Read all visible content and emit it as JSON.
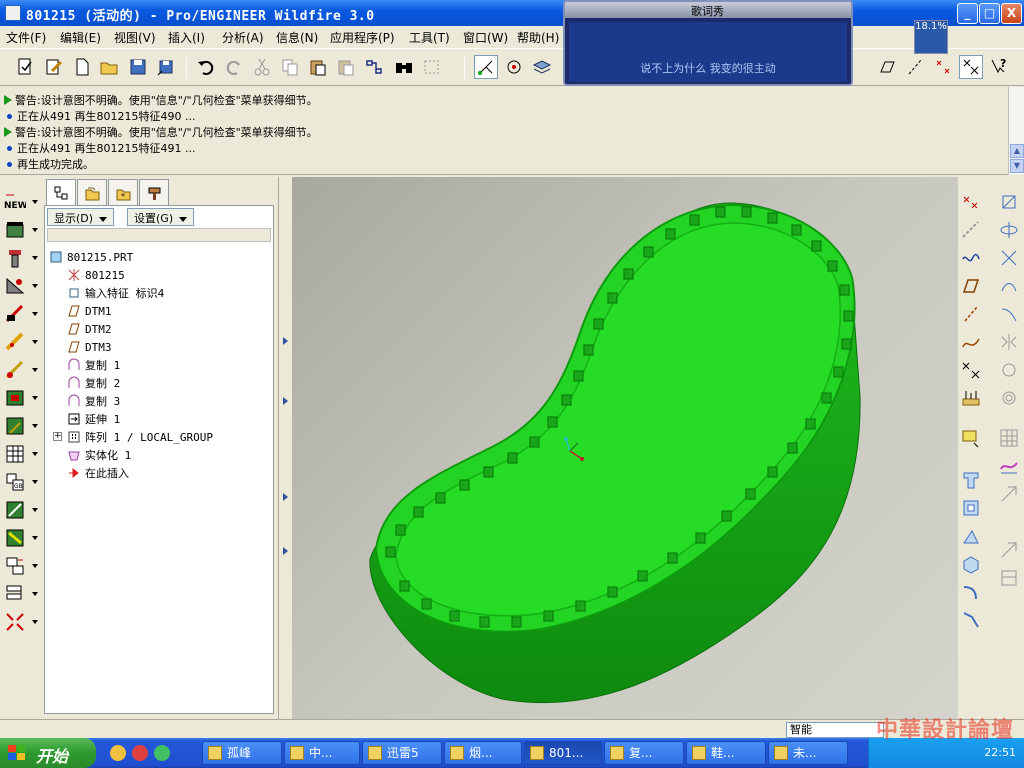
{
  "window": {
    "title": "801215 (活动的) - Pro/ENGINEER Wildfire 3.0",
    "min_label": "_",
    "max_label": "□",
    "close_label": "X"
  },
  "menu": {
    "items": [
      "文件(F)",
      "编辑(E)",
      "视图(V)",
      "插入(I)",
      "分析(A)",
      "信息(N)",
      "应用程序(P)",
      "工具(T)",
      "窗口(W)",
      "帮助(H)"
    ]
  },
  "messages": {
    "lines": [
      {
        "type": "warning",
        "text": "警告:设计意图不明确。使用\"信息\"/\"几何检查\"菜单获得细节。"
      },
      {
        "type": "info",
        "text": "正在从491 再生801215特征490 ..."
      },
      {
        "type": "warning",
        "text": "警告:设计意图不明确。使用\"信息\"/\"几何检查\"菜单获得细节。"
      },
      {
        "type": "info",
        "text": "正在从491 再生801215特征491 ..."
      },
      {
        "type": "info",
        "text": "再生成功完成。"
      }
    ]
  },
  "lyric_window": {
    "title": "歌词秀",
    "lyric": "说不上为什么 我变的很主动"
  },
  "zoom": "18.1%",
  "nav": {
    "show_label": "显示(D)",
    "settings_label": "设置(G)",
    "tree": [
      {
        "label": "801215.PRT",
        "icon": "part-icon",
        "level": 0
      },
      {
        "label": "801215",
        "icon": "csys-icon",
        "level": 1
      },
      {
        "label": "输入特征 标识4",
        "icon": "import-icon",
        "level": 1
      },
      {
        "label": "DTM1",
        "icon": "datum-plane-icon",
        "level": 1
      },
      {
        "label": "DTM2",
        "icon": "datum-plane-icon",
        "level": 1
      },
      {
        "label": "DTM3",
        "icon": "datum-plane-icon",
        "level": 1
      },
      {
        "label": "复制 1",
        "icon": "copy-surface-icon",
        "level": 1
      },
      {
        "label": "复制 2",
        "icon": "copy-surface-icon",
        "level": 1
      },
      {
        "label": "复制 3",
        "icon": "copy-surface-icon",
        "level": 1
      },
      {
        "label": "延伸 1",
        "icon": "extend-icon",
        "level": 1
      },
      {
        "label": "阵列 1 / LOCAL_GROUP",
        "icon": "pattern-icon",
        "level": 1,
        "expandable": true
      },
      {
        "label": "实体化 1",
        "icon": "solidify-icon",
        "level": 1
      },
      {
        "label": "在此插入",
        "icon": "insert-here-icon",
        "level": 1
      }
    ]
  },
  "left_toolbar": {
    "new_label": "NEW"
  },
  "status": {
    "filter_value": "智能"
  },
  "taskbar": {
    "start_label": "开始",
    "tasks": [
      "孤峰",
      "中...",
      "迅雷5",
      "烟...",
      "801...",
      "复...",
      "鞋...",
      "未..."
    ],
    "active_index": 4,
    "clock": "22:51"
  },
  "watermark": "中華設計論壇",
  "colors": {
    "model_green": "#22d322",
    "model_dark": "#109010",
    "titlebar": "#0a5ae0"
  }
}
